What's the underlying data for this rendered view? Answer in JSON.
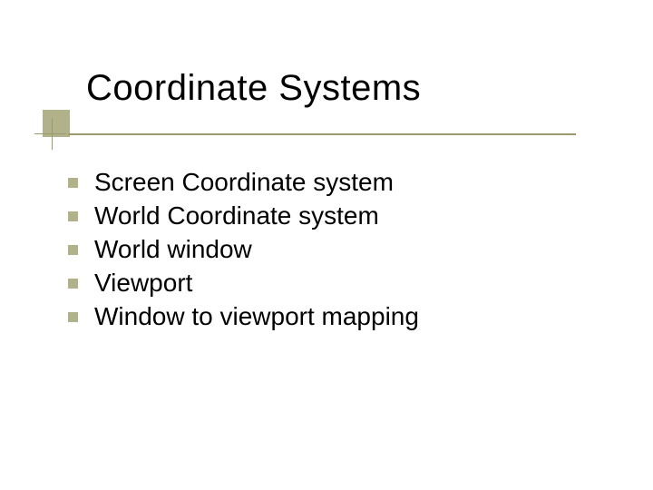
{
  "slide": {
    "title": "Coordinate Systems",
    "bullets": [
      "Screen Coordinate system",
      "World Coordinate system",
      "World window",
      "Viewport",
      "Window to viewport mapping"
    ]
  }
}
